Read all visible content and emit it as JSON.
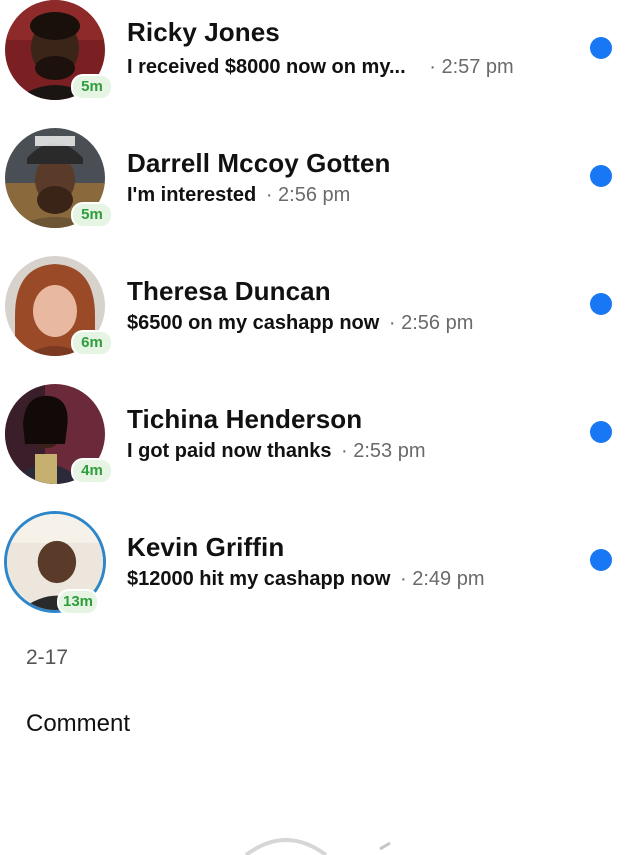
{
  "conversations": [
    {
      "name": "Ricky Jones",
      "message": "I received $8000 now on my...",
      "separator": "·",
      "time": "2:57 pm",
      "badge": "5m",
      "avatar": "person-photo-icon"
    },
    {
      "name": "Darrell Mccoy Gotten",
      "message": "I'm interested",
      "separator": "·",
      "time": "2:56 pm",
      "badge": "5m",
      "avatar": "person-photo-icon"
    },
    {
      "name": "Theresa Duncan",
      "message": "$6500 on my cashapp now",
      "separator": "·",
      "time": "2:56 pm",
      "badge": "6m",
      "avatar": "person-photo-icon"
    },
    {
      "name": "Tichina Henderson",
      "message": "I got paid now thanks",
      "separator": "·",
      "time": "2:53 pm",
      "badge": "4m",
      "avatar": "person-photo-icon"
    },
    {
      "name": "Kevin Griffin",
      "message": "$12000 hit my cashapp now",
      "separator": "·",
      "time": "2:49 pm",
      "badge": "13m",
      "avatar": "person-photo-icon"
    }
  ],
  "date_label": "2-17",
  "comment_label": "Comment",
  "colors": {
    "unread_dot": "#1877f2",
    "badge_text": "#2e9e3c",
    "badge_bg": "#e6f4e3",
    "story_ring": "#2d86c9"
  }
}
